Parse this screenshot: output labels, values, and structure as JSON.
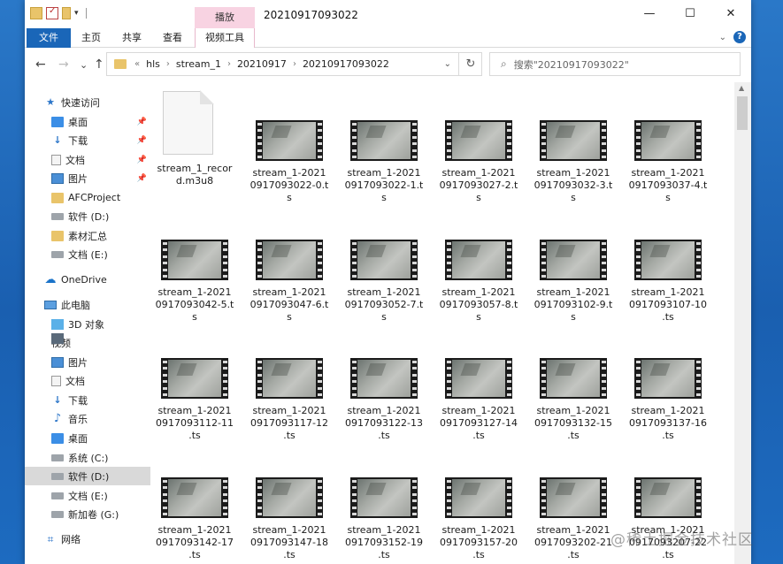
{
  "window": {
    "title": "20210917093022",
    "tool_tab_header": "播放",
    "controls": {
      "minimize": "—",
      "maximize": "☐",
      "close": "✕"
    }
  },
  "ribbon": {
    "tabs": [
      {
        "label": "文件"
      },
      {
        "label": "主页"
      },
      {
        "label": "共享"
      },
      {
        "label": "查看"
      },
      {
        "label": "视频工具"
      }
    ],
    "help": "?"
  },
  "nav": {
    "back": "←",
    "forward": "→",
    "recent": "⌄",
    "up": "↑",
    "overflow": "«",
    "breadcrumb": [
      "hls",
      "stream_1",
      "20210917",
      "20210917093022"
    ],
    "refresh": "↻",
    "search_placeholder": "搜索\"20210917093022\""
  },
  "sidebar": {
    "items": [
      {
        "label": "快速访问",
        "icon": "star-icon"
      },
      {
        "label": "桌面",
        "icon": "desktop-icon",
        "pinned": true
      },
      {
        "label": "下载",
        "icon": "download-icon",
        "pinned": true
      },
      {
        "label": "文档",
        "icon": "document-icon",
        "pinned": true
      },
      {
        "label": "图片",
        "icon": "picture-icon",
        "pinned": true
      },
      {
        "label": "AFCProject",
        "icon": "folder-icon"
      },
      {
        "label": "软件 (D:)",
        "icon": "drive-icon"
      },
      {
        "label": "素材汇总",
        "icon": "folder-icon"
      },
      {
        "label": "文档 (E:)",
        "icon": "drive-icon"
      },
      {
        "label": "OneDrive",
        "icon": "cloud-icon"
      },
      {
        "label": "此电脑",
        "icon": "computer-icon"
      },
      {
        "label": "3D 对象",
        "icon": "cube-icon"
      },
      {
        "label": "视频",
        "icon": "video-icon"
      },
      {
        "label": "图片",
        "icon": "picture-icon"
      },
      {
        "label": "文档",
        "icon": "document-icon"
      },
      {
        "label": "下载",
        "icon": "download-icon"
      },
      {
        "label": "音乐",
        "icon": "music-icon"
      },
      {
        "label": "桌面",
        "icon": "desktop-icon"
      },
      {
        "label": "系统 (C:)",
        "icon": "drive-icon"
      },
      {
        "label": "软件 (D:)",
        "icon": "drive-icon",
        "selected": true
      },
      {
        "label": "文档 (E:)",
        "icon": "drive-icon"
      },
      {
        "label": "新加卷 (G:)",
        "icon": "drive-icon"
      },
      {
        "label": "网络",
        "icon": "network-icon"
      }
    ]
  },
  "files": [
    {
      "name_lines": [
        "stream_1_recor",
        "d.m3u8"
      ],
      "kind": "document"
    },
    {
      "name_lines": [
        "stream_1-2021",
        "0917093022-0.t",
        "s"
      ],
      "kind": "video"
    },
    {
      "name_lines": [
        "stream_1-2021",
        "0917093022-1.t",
        "s"
      ],
      "kind": "video"
    },
    {
      "name_lines": [
        "stream_1-2021",
        "0917093027-2.t",
        "s"
      ],
      "kind": "video"
    },
    {
      "name_lines": [
        "stream_1-2021",
        "0917093032-3.t",
        "s"
      ],
      "kind": "video"
    },
    {
      "name_lines": [
        "stream_1-2021",
        "0917093037-4.t",
        "s"
      ],
      "kind": "video"
    },
    {
      "name_lines": [
        "stream_1-2021",
        "0917093042-5.t",
        "s"
      ],
      "kind": "video"
    },
    {
      "name_lines": [
        "stream_1-2021",
        "0917093047-6.t",
        "s"
      ],
      "kind": "video"
    },
    {
      "name_lines": [
        "stream_1-2021",
        "0917093052-7.t",
        "s"
      ],
      "kind": "video"
    },
    {
      "name_lines": [
        "stream_1-2021",
        "0917093057-8.t",
        "s"
      ],
      "kind": "video"
    },
    {
      "name_lines": [
        "stream_1-2021",
        "0917093102-9.t",
        "s"
      ],
      "kind": "video"
    },
    {
      "name_lines": [
        "stream_1-2021",
        "0917093107-10",
        ".ts"
      ],
      "kind": "video"
    },
    {
      "name_lines": [
        "stream_1-2021",
        "0917093112-11",
        ".ts"
      ],
      "kind": "video"
    },
    {
      "name_lines": [
        "stream_1-2021",
        "0917093117-12",
        ".ts"
      ],
      "kind": "video"
    },
    {
      "name_lines": [
        "stream_1-2021",
        "0917093122-13",
        ".ts"
      ],
      "kind": "video"
    },
    {
      "name_lines": [
        "stream_1-2021",
        "0917093127-14",
        ".ts"
      ],
      "kind": "video"
    },
    {
      "name_lines": [
        "stream_1-2021",
        "0917093132-15",
        ".ts"
      ],
      "kind": "video"
    },
    {
      "name_lines": [
        "stream_1-2021",
        "0917093137-16",
        ".ts"
      ],
      "kind": "video"
    },
    {
      "name_lines": [
        "stream_1-2021",
        "0917093142-17",
        ".ts"
      ],
      "kind": "video"
    },
    {
      "name_lines": [
        "stream_1-2021",
        "0917093147-18",
        ".ts"
      ],
      "kind": "video"
    },
    {
      "name_lines": [
        "stream_1-2021",
        "0917093152-19",
        ".ts"
      ],
      "kind": "video"
    },
    {
      "name_lines": [
        "stream_1-2021",
        "0917093157-20",
        ".ts"
      ],
      "kind": "video"
    },
    {
      "name_lines": [
        "stream_1-2021",
        "0917093202-21",
        ".ts"
      ],
      "kind": "video"
    },
    {
      "name_lines": [
        "stream_1-2021",
        "0917093207-22",
        ".ts"
      ],
      "kind": "video"
    }
  ],
  "watermark": "@稀土掘金技术社区"
}
